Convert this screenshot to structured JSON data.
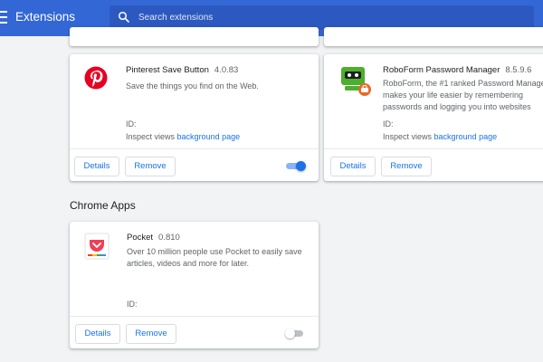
{
  "header": {
    "title": "Extensions",
    "search_placeholder": "Search extensions",
    "bar_color": "#3367d6"
  },
  "extensions": [
    {
      "name": "Pinterest Save Button",
      "version": "4.0.83",
      "description": [
        "Save the things you find on the Web."
      ],
      "id_label": "ID:",
      "inspect_label": "Inspect views",
      "inspect_link": "background page",
      "details_label": "Details",
      "remove_label": "Remove",
      "enabled": true,
      "icon": "pinterest-logo-icon"
    },
    {
      "name": "RoboForm Password Manager",
      "version": "8.5.9.6",
      "description": [
        "RoboForm, the #1 ranked Password Manage",
        "makes your life easier by remembering",
        "passwords and logging you into websites"
      ],
      "id_label": "ID:",
      "inspect_label": "Inspect views",
      "inspect_link": "background page",
      "details_label": "Details",
      "remove_label": "Remove",
      "icon": "roboform-logo-icon"
    }
  ],
  "apps_section": {
    "title": "Chrome Apps",
    "apps": [
      {
        "name": "Pocket",
        "version": "0.810",
        "description": [
          "Over 10 million people use Pocket to easily save",
          "articles, videos and more for later."
        ],
        "id_label": "ID:",
        "details_label": "Details",
        "remove_label": "Remove",
        "enabled": false,
        "icon": "pocket-logo-icon"
      }
    ]
  },
  "colors": {
    "accent": "#1a73e8",
    "pinterest": "#e60023",
    "roboform_green": "#4caf2d",
    "roboform_orange": "#e8692c",
    "pocket": "#ef4056"
  }
}
